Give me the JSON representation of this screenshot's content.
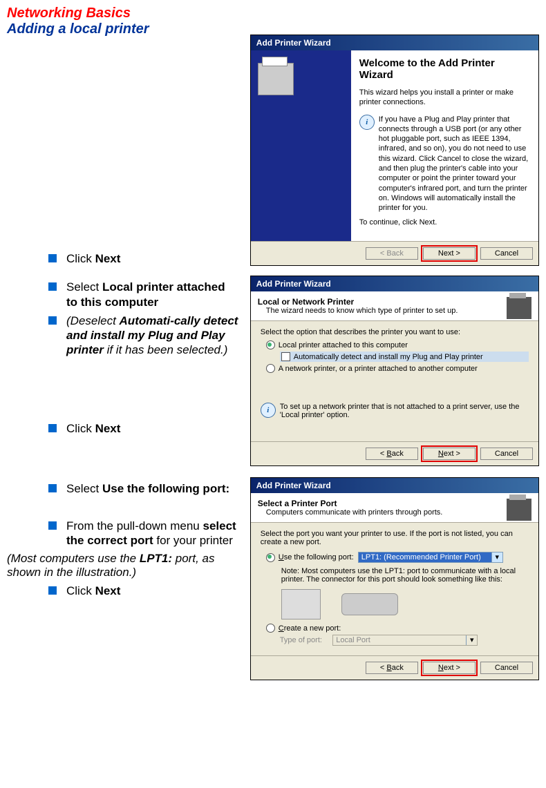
{
  "page": {
    "title_line1": "Networking Basics",
    "title_line2": "Adding a local printer"
  },
  "steps": {
    "click_next_1": {
      "pre": "Click ",
      "bold": "Next"
    },
    "select_local": {
      "pre": "Select ",
      "bold": "Local printer attached to this computer"
    },
    "deselect": {
      "pre_it": "(Deselect ",
      "bold_it": "Automati-cally detect and install my Plug and Play printer",
      "post_it": " if it has been selected.)"
    },
    "click_next_2": {
      "pre": "Click ",
      "bold": "Next"
    },
    "select_port": {
      "pre": "Select ",
      "bold": "Use the following port:"
    },
    "pulldown": {
      "pre": "From the pull-down menu ",
      "bold": "select the correct port",
      "post": " for your printer"
    },
    "note_lpt": {
      "pre_it": "(Most computers use the ",
      "bold_it": "LPT1:",
      "post_it": " port, as shown in the illustration.)"
    },
    "click_next_3": {
      "pre": "Click ",
      "bold": "Next"
    }
  },
  "wiz1": {
    "titlebar": "Add Printer Wizard",
    "welcome": "Welcome to the Add Printer Wizard",
    "intro": "This wizard helps you install a printer or make printer connections.",
    "info": "If you have a Plug and Play printer that connects through a USB port (or any other hot pluggable port, such as IEEE 1394, infrared, and so on), you do not need to use this wizard. Click Cancel to close the wizard, and then plug the printer's cable into your computer or point the printer toward your computer's infrared port, and turn the printer on. Windows will automatically install the printer for you.",
    "cont": "To continue, click Next.",
    "back": "< Back",
    "next": "Next >",
    "cancel": "Cancel"
  },
  "wiz2": {
    "titlebar": "Add Printer Wizard",
    "hdr": "Local or Network Printer",
    "sub": "The wizard needs to know which type of printer to set up.",
    "prompt": "Select the option that describes the printer you want to use:",
    "opt1": "Local printer attached to this computer",
    "chk": "Automatically detect and install my Plug and Play printer",
    "opt2": "A network printer, or a printer attached to another computer",
    "info": "To set up a network printer that is not attached to a print server, use the 'Local printer' option.",
    "back": "< Back",
    "next": "Next >",
    "cancel": "Cancel"
  },
  "wiz3": {
    "titlebar": "Add Printer Wizard",
    "hdr": "Select a Printer Port",
    "sub": "Computers communicate with printers through ports.",
    "prompt": "Select the port you want your printer to use.  If the port is not listed, you can create a new port.",
    "opt1": "Use the following port:",
    "combo": "LPT1: (Recommended Printer Port)",
    "note": "Note: Most computers use the LPT1: port to communicate with a local printer. The connector for this port should look something like this:",
    "opt2": "Create a new port:",
    "type_lbl": "Type of port:",
    "type_val": "Local Port",
    "back": "< Back",
    "next": "Next >",
    "cancel": "Cancel"
  }
}
